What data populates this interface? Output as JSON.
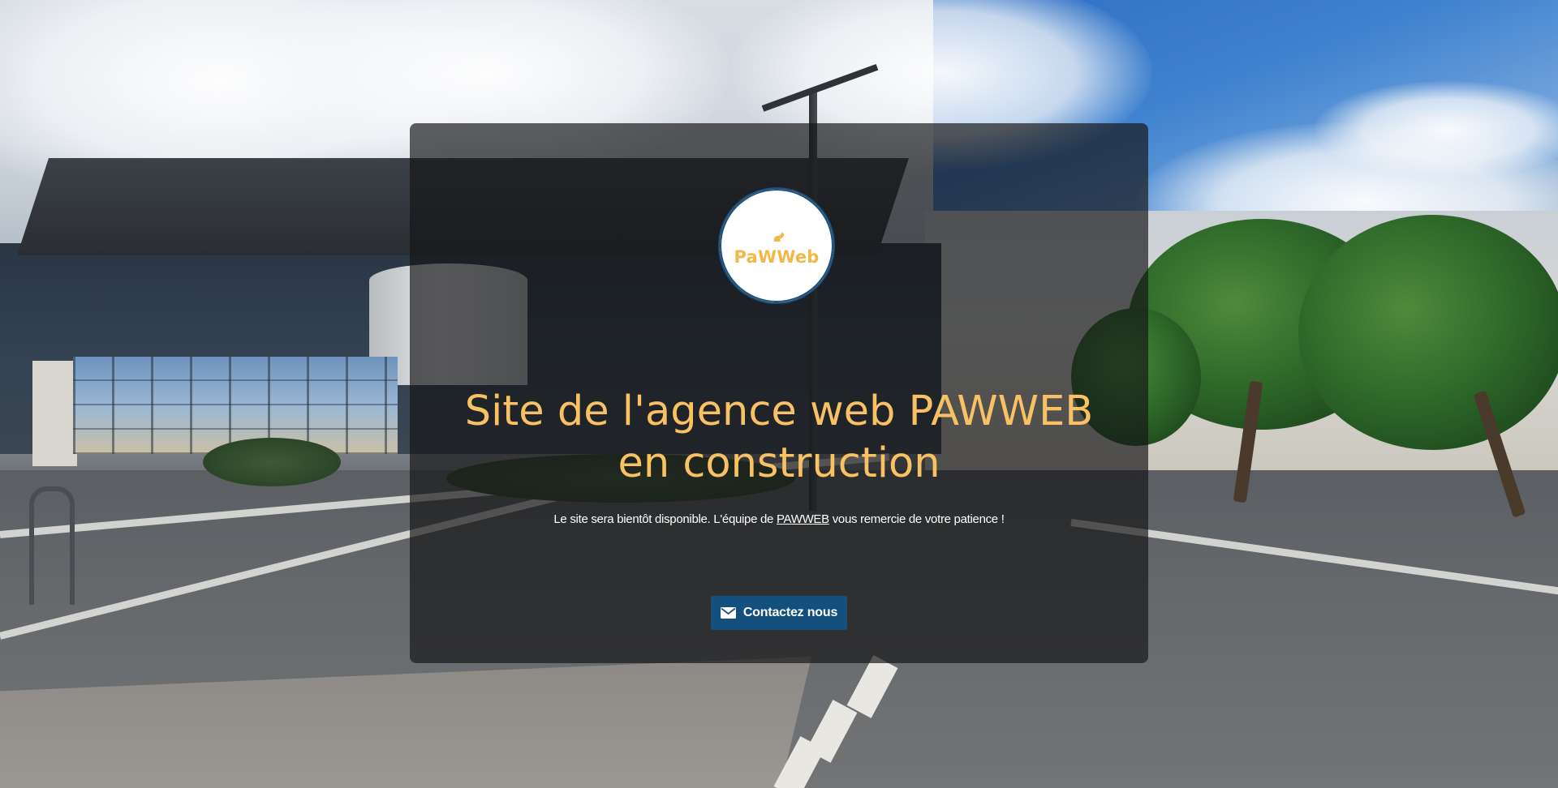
{
  "logo": {
    "text": "PaWWeb",
    "icon": "paw-cat-icon",
    "text_color": "#f2b94a",
    "ring_color": "#1d4f78"
  },
  "headline": {
    "line1": "Site de l'agence web PAWWEB",
    "line2": "en construction",
    "color": "#f7c164"
  },
  "subtitle": {
    "before": "Le site sera bientôt disponible. L'équipe de ",
    "link": "PAWWEB",
    "after": " vous remercie de votre patience !"
  },
  "contact_button": {
    "label": "Contactez nous",
    "icon": "envelope-icon",
    "color": "#14507e"
  },
  "overlay": {
    "background": "rgba(20,20,22,0.68)"
  }
}
